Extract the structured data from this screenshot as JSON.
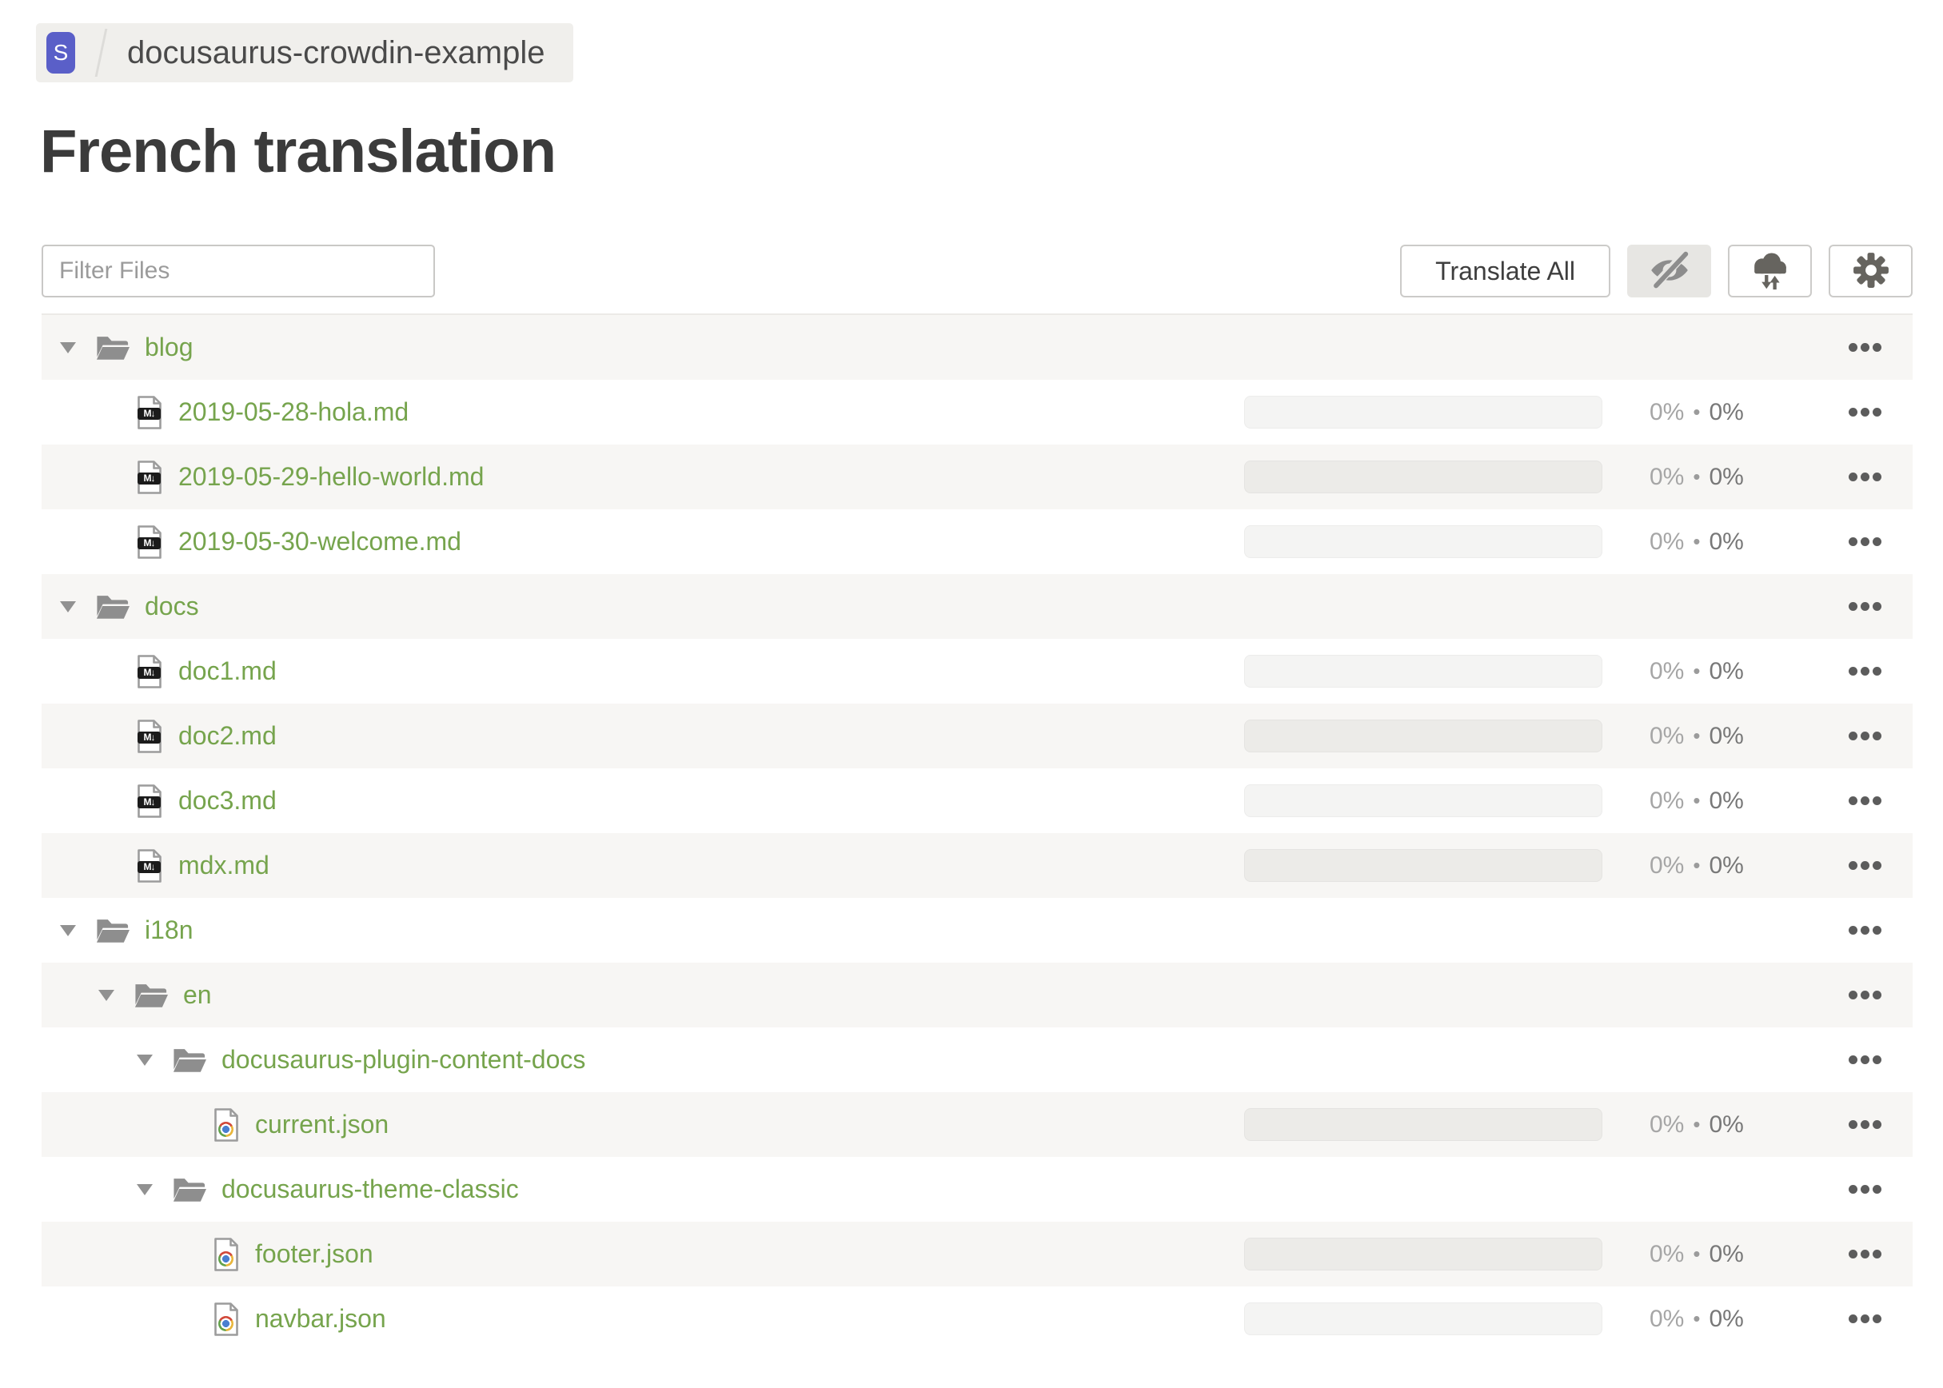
{
  "breadcrumb": {
    "badge_letter": "S",
    "project": "docusaurus-crowdin-example"
  },
  "page": {
    "title": "French translation"
  },
  "toolbar": {
    "filter_placeholder": "Filter Files",
    "translate_all": "Translate All",
    "icon_buttons": [
      "eye-slash",
      "cloud-sync",
      "gear"
    ]
  },
  "icons": {
    "markdown_badge": "M↓"
  },
  "progress": {
    "separator": "•"
  },
  "colors": {
    "accent_green": "#76a44d",
    "badge_indigo": "#5a5fc8",
    "row_alt_bg": "#f7f6f4",
    "icon_gray": "#8e8e8e",
    "percent_translated_gray": "#a6a6a6",
    "percent_approved_gray": "#787878"
  },
  "tree": {
    "rows": [
      {
        "type": "folder",
        "name": "blog",
        "level": 0
      },
      {
        "type": "file",
        "file_type": "markdown",
        "name": "2019-05-28-hola.md",
        "level": 1,
        "translated": "0%",
        "approved": "0%"
      },
      {
        "type": "file",
        "file_type": "markdown",
        "name": "2019-05-29-hello-world.md",
        "level": 1,
        "translated": "0%",
        "approved": "0%"
      },
      {
        "type": "file",
        "file_type": "markdown",
        "name": "2019-05-30-welcome.md",
        "level": 1,
        "translated": "0%",
        "approved": "0%"
      },
      {
        "type": "folder",
        "name": "docs",
        "level": 0
      },
      {
        "type": "file",
        "file_type": "markdown",
        "name": "doc1.md",
        "level": 1,
        "translated": "0%",
        "approved": "0%"
      },
      {
        "type": "file",
        "file_type": "markdown",
        "name": "doc2.md",
        "level": 1,
        "translated": "0%",
        "approved": "0%"
      },
      {
        "type": "file",
        "file_type": "markdown",
        "name": "doc3.md",
        "level": 1,
        "translated": "0%",
        "approved": "0%"
      },
      {
        "type": "file",
        "file_type": "markdown",
        "name": "mdx.md",
        "level": 1,
        "translated": "0%",
        "approved": "0%"
      },
      {
        "type": "folder",
        "name": "i18n",
        "level": 0
      },
      {
        "type": "folder",
        "name": "en",
        "level": 1
      },
      {
        "type": "folder",
        "name": "docusaurus-plugin-content-docs",
        "level": 2
      },
      {
        "type": "file",
        "file_type": "json",
        "name": "current.json",
        "level": 3,
        "translated": "0%",
        "approved": "0%"
      },
      {
        "type": "folder",
        "name": "docusaurus-theme-classic",
        "level": 2
      },
      {
        "type": "file",
        "file_type": "json",
        "name": "footer.json",
        "level": 3,
        "translated": "0%",
        "approved": "0%"
      },
      {
        "type": "file",
        "file_type": "json",
        "name": "navbar.json",
        "level": 3,
        "translated": "0%",
        "approved": "0%"
      }
    ]
  }
}
